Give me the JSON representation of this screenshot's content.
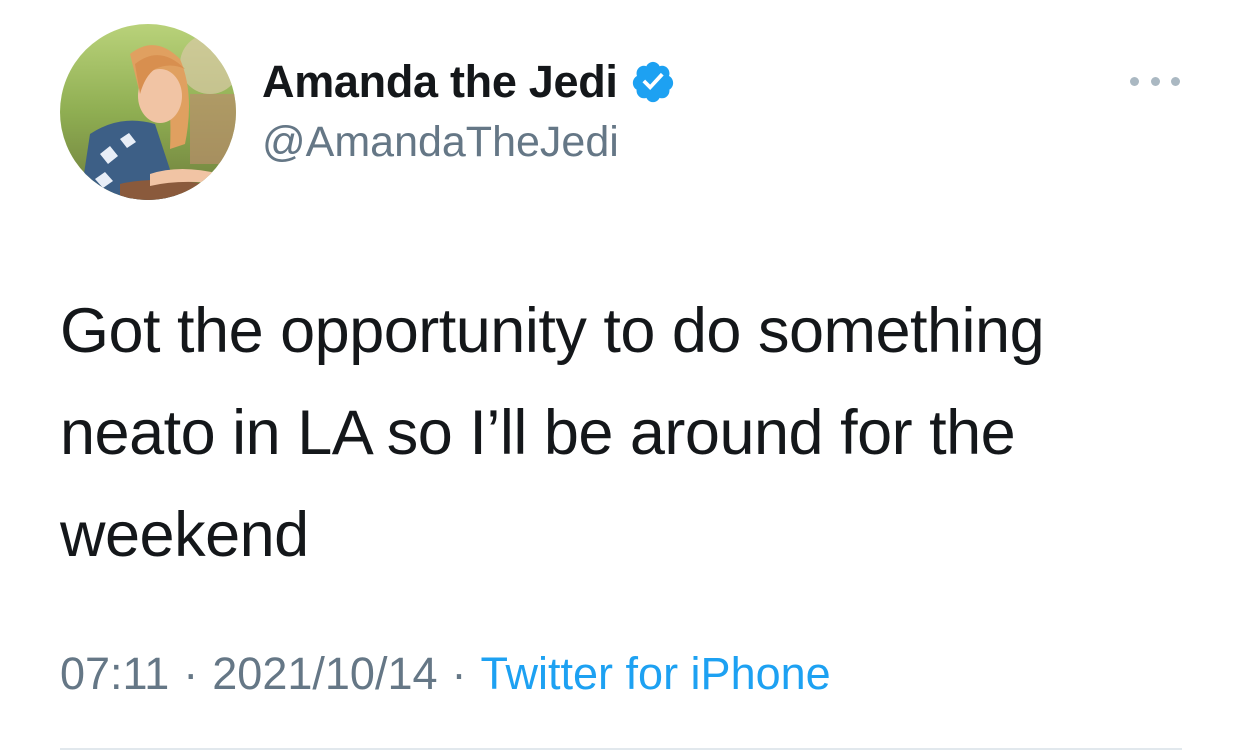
{
  "author": {
    "name": "Amanda the Jedi",
    "handle": "@AmandaTheJedi",
    "verified": true,
    "avatar_icon": "profile-photo",
    "verified_color": "#1da1f2"
  },
  "menu": {
    "icon": "more-dots-icon"
  },
  "tweet": {
    "text": "Got the opportunity to do something\nneato in LA so I’ll be around for the\nweekend"
  },
  "meta": {
    "time": "07:11",
    "separator": "·",
    "date": "2021/10/14",
    "source": "Twitter for iPhone"
  },
  "colors": {
    "text": "#14171a",
    "secondary": "#657786",
    "link": "#1da1f2",
    "divider": "#e1e8ed"
  }
}
